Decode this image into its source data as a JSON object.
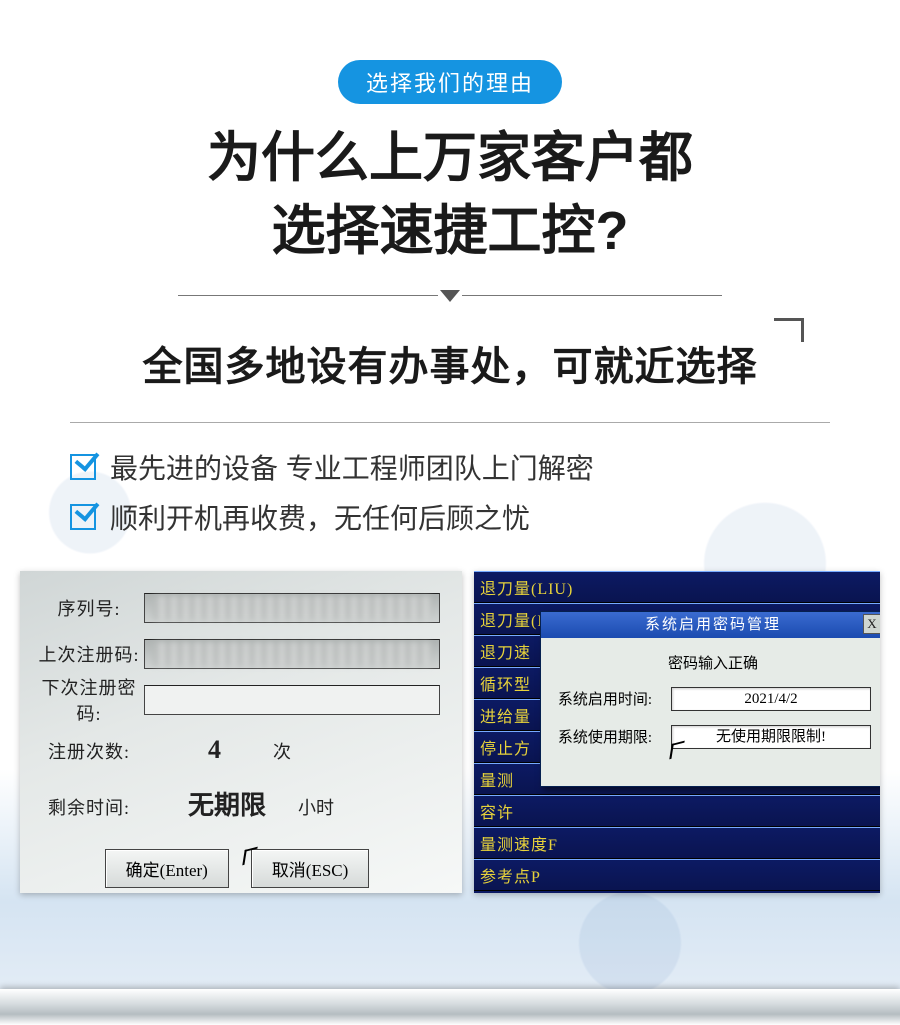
{
  "badge": "选择我们的理由",
  "hero_l1": "为什么上万家客户都",
  "hero_l2": "选择速捷工控?",
  "subheadline": "全国多地设有办事处，可就近选择",
  "bullets": [
    "最先进的设备 专业工程师团队上门解密",
    "顺利开机再收费，无任何后顾之忧"
  ],
  "left": {
    "serial_label": "序列号:",
    "last_code_label": "上次注册码:",
    "next_pwd_label": "下次注册密码:",
    "count_label": "注册次数:",
    "count_value": "4",
    "count_unit": "次",
    "remain_label": "剩余时间:",
    "remain_value": "无期限",
    "remain_unit": "小时",
    "ok": "确定(Enter)",
    "cancel": "取消(ESC)"
  },
  "right": {
    "rows": [
      "退刀量(LIU)",
      "退刀量(LIU)",
      "退刀速",
      "循环型",
      "进给量",
      "停止方",
      "量测",
      "容许",
      "量测速度F",
      "参考点P"
    ],
    "dlg_title": "系统启用密码管理",
    "dlg_close": "X",
    "pwd_ok": "密码输入正确",
    "time_k": "系统启用时间:",
    "time_v": "2021/4/2",
    "limit_k": "系统使用期限:",
    "limit_v": "无使用期限限制!"
  }
}
